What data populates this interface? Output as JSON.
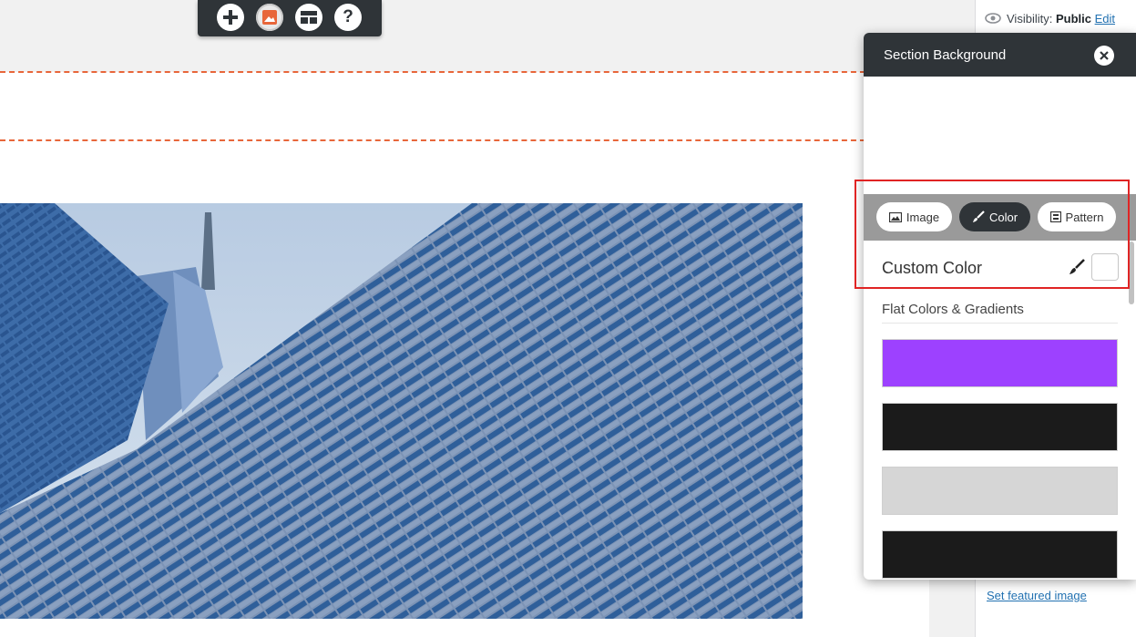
{
  "toolbar": {
    "buttons": [
      {
        "icon": "plus-icon"
      },
      {
        "icon": "background-image-icon",
        "active": true
      },
      {
        "icon": "layout-icon"
      },
      {
        "icon": "help-icon"
      }
    ]
  },
  "wp_sidebar": {
    "visibility_label": "Visibility:",
    "visibility_value": "Public",
    "edit_link": "Edit",
    "featured_image_link": "Set featured image"
  },
  "panel": {
    "title": "Section Background",
    "tabs": [
      {
        "label": "Image",
        "icon": "image-icon"
      },
      {
        "label": "Color",
        "icon": "brush-icon",
        "active": true
      },
      {
        "label": "Pattern",
        "icon": "pattern-icon"
      }
    ],
    "custom_color_label": "Custom Color",
    "custom_color_value": "#ffffff",
    "flat_title": "Flat Colors & Gradients",
    "swatches": [
      "#9d41ff",
      "#1b1b1b",
      "#d6d6d6",
      "#1b1b1b"
    ]
  },
  "colors": {
    "accent_dash": "#e8663a",
    "toolbar_bg": "#2f3438",
    "highlight": "#e02424",
    "link": "#2271b1"
  }
}
